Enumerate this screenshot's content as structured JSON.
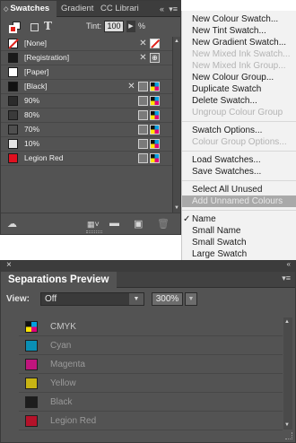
{
  "swatches_panel": {
    "tabs": [
      "Swatches",
      "Gradient",
      "CC Librari"
    ],
    "tab_collapse_glyph": "«",
    "tab_menu_glyph": "▾≡",
    "tint_label": "Tint:",
    "tint_value": "100",
    "tint_unit": "%",
    "fill_color": "#e0201a",
    "items": [
      {
        "name": "[None]",
        "color": "none",
        "icons": [
          "no-edit",
          "red-slash"
        ]
      },
      {
        "name": "[Registration]",
        "color": "#1a1a1a",
        "icons": [
          "no-edit",
          "registration"
        ]
      },
      {
        "name": "[Paper]",
        "color": "#ffffff",
        "icons": []
      },
      {
        "name": "[Black]",
        "color": "#111111",
        "icons": [
          "no-edit",
          "process",
          "cmyk"
        ]
      },
      {
        "name": "90%",
        "color": "#2b2b2b",
        "icons": [
          "process",
          "cmyk"
        ]
      },
      {
        "name": "80%",
        "color": "#3a3a3a",
        "icons": [
          "process",
          "cmyk"
        ]
      },
      {
        "name": "70%",
        "color": "#4f4f4f",
        "icons": [
          "process",
          "cmyk"
        ]
      },
      {
        "name": "10%",
        "color": "#e6e6e6",
        "icons": [
          "process",
          "cmyk"
        ]
      },
      {
        "name": "Legion Red",
        "color": "#e0101f",
        "icons": [
          "process",
          "cmyk"
        ]
      }
    ]
  },
  "context_menu": {
    "items": [
      {
        "label": "New Colour Swatch...",
        "enabled": true
      },
      {
        "label": "New Tint Swatch...",
        "enabled": true
      },
      {
        "label": "New Gradient Swatch...",
        "enabled": true
      },
      {
        "label": "New Mixed Ink Swatch...",
        "enabled": false
      },
      {
        "label": "New Mixed Ink Group...",
        "enabled": false
      },
      {
        "label": "New Colour Group...",
        "enabled": true
      },
      {
        "label": "Duplicate Swatch",
        "enabled": true
      },
      {
        "label": "Delete Swatch...",
        "enabled": true
      },
      {
        "label": "Ungroup Colour Group",
        "enabled": false
      },
      {
        "separator": true
      },
      {
        "label": "Swatch Options...",
        "enabled": true
      },
      {
        "label": "Colour Group Options...",
        "enabled": false
      },
      {
        "separator": true
      },
      {
        "label": "Load Swatches...",
        "enabled": true
      },
      {
        "label": "Save Swatches...",
        "enabled": true
      },
      {
        "separator": true
      },
      {
        "label": "Select All Unused",
        "enabled": true
      },
      {
        "label": "Add Unnamed Colours",
        "enabled": true,
        "highlighted": true
      },
      {
        "separator": true
      },
      {
        "label": "Name",
        "enabled": true,
        "checked": true
      },
      {
        "label": "Small Name",
        "enabled": true
      },
      {
        "label": "Small Swatch",
        "enabled": true
      },
      {
        "label": "Large Swatch",
        "enabled": true
      }
    ]
  },
  "separations_panel": {
    "title": "Separations Preview",
    "close_glyph": "×",
    "collapse_glyph": "«",
    "menu_glyph": "▾≡",
    "view_label": "View:",
    "view_value": "Off",
    "zoom_value": "300%",
    "separations": [
      {
        "name": "CMYK",
        "color": "cmyk"
      },
      {
        "name": "Cyan",
        "color": "#0a8fb5"
      },
      {
        "name": "Magenta",
        "color": "#c0157d"
      },
      {
        "name": "Yellow",
        "color": "#c8b414"
      },
      {
        "name": "Black",
        "color": "#1d1d1d"
      },
      {
        "name": "Legion Red",
        "color": "#b5122a"
      }
    ]
  }
}
